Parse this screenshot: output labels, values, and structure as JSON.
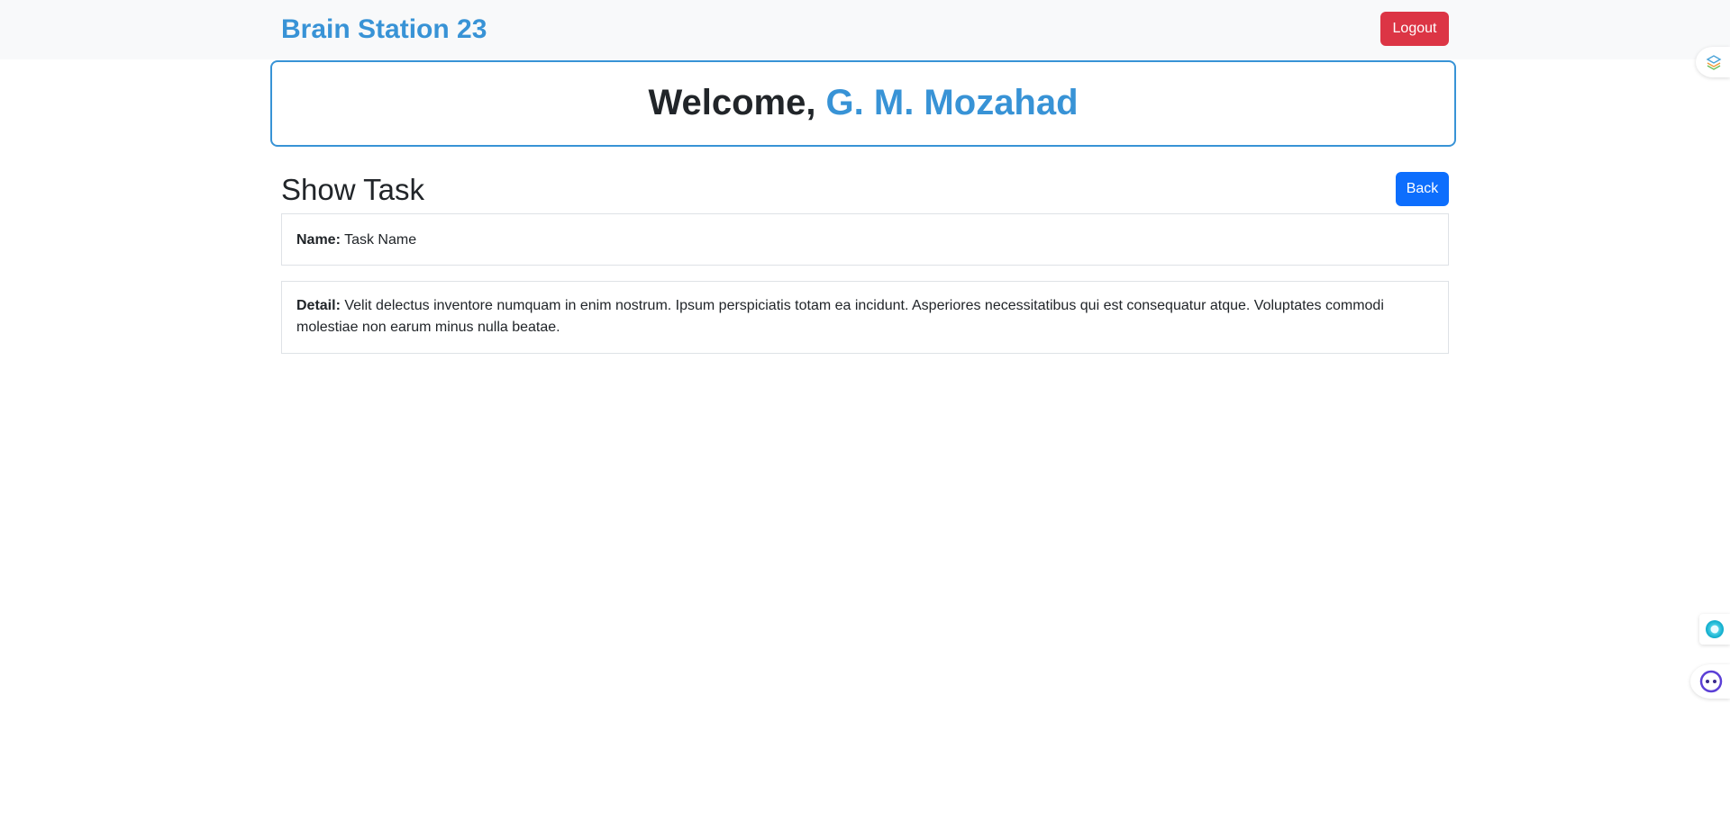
{
  "navbar": {
    "brand": "Brain Station 23",
    "logout_label": "Logout"
  },
  "welcome": {
    "prefix": "Welcome, ",
    "name": "G. M. Mozahad"
  },
  "page": {
    "title": "Show Task",
    "back_label": "Back"
  },
  "task": {
    "name_label": "Name:",
    "name_value": "Task Name",
    "detail_label": "Detail:",
    "detail_value": "Velit delectus inventore numquam in enim nostrum. Ipsum perspiciatis totam ea incidunt. Asperiores necessitatibus qui est consequatur atque. Voluptates commodi molestiae non earum minus nulla beatae."
  },
  "side_widgets": [
    "layers-extension-icon",
    "circle-assistant-icon",
    "robot-face-icon"
  ],
  "colors": {
    "accent": "#3893d6",
    "danger": "#dc3545",
    "primary": "#0d6efd",
    "navbar_bg": "#f8f9fa"
  }
}
